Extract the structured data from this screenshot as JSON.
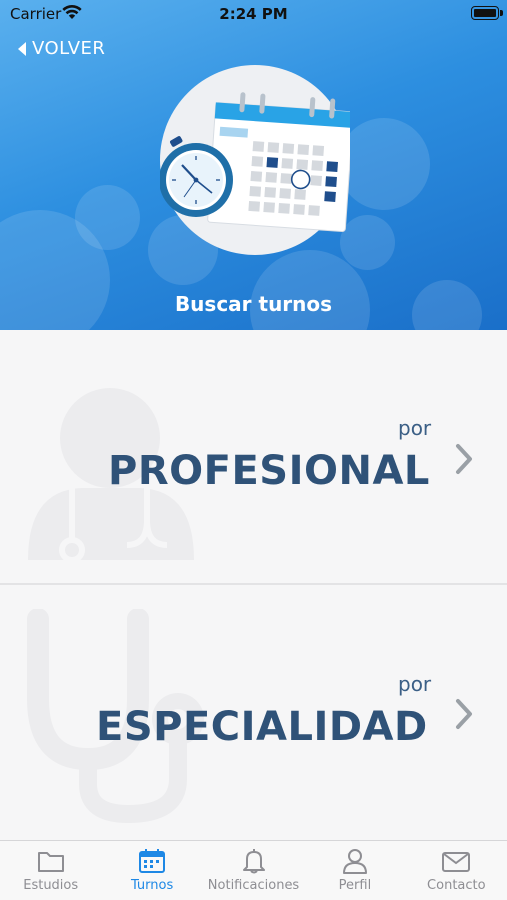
{
  "status_bar": {
    "carrier": "Carrier",
    "time": "2:24 PM"
  },
  "header": {
    "back_label": "VOLVER",
    "title": "Buscar turnos",
    "bg_color": "#2d8fe0"
  },
  "options": [
    {
      "prefix": "por",
      "label": "PROFESIONAL",
      "icon": "doctor-icon"
    },
    {
      "prefix": "por",
      "label": "ESPECIALIDAD",
      "icon": "stethoscope-icon"
    }
  ],
  "tabs": [
    {
      "label": "Estudios",
      "icon": "folder-icon",
      "active": false
    },
    {
      "label": "Turnos",
      "icon": "calendar-icon",
      "active": true
    },
    {
      "label": "Notificaciones",
      "icon": "bell-icon",
      "active": false
    },
    {
      "label": "Perfil",
      "icon": "person-icon",
      "active": false
    },
    {
      "label": "Contacto",
      "icon": "mail-icon",
      "active": false
    }
  ],
  "colors": {
    "accent": "#1e88e5",
    "text_dark_blue": "#2f5278",
    "tab_inactive": "#8e8e93"
  }
}
